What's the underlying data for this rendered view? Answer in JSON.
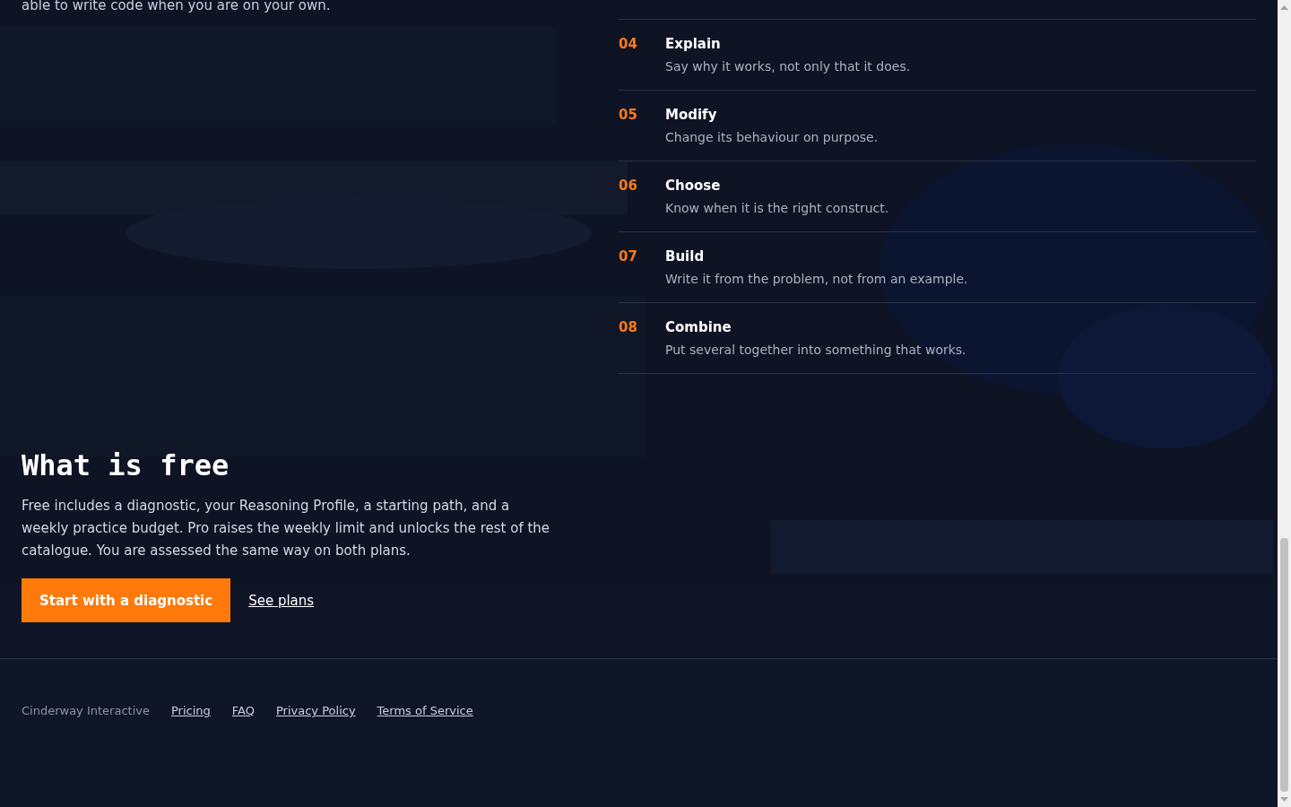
{
  "intro_tail": "able to write code when you are on your own.",
  "steps": [
    {
      "number": "04",
      "title": "Explain",
      "text": "Say why it works, not only that it does."
    },
    {
      "number": "05",
      "title": "Modify",
      "text": "Change its behaviour on purpose."
    },
    {
      "number": "06",
      "title": "Choose",
      "text": "Know when it is the right construct."
    },
    {
      "number": "07",
      "title": "Build",
      "text": "Write it from the problem, not from an example."
    },
    {
      "number": "08",
      "title": "Combine",
      "text": "Put several together into something that works."
    }
  ],
  "free": {
    "heading": "What is free",
    "text": "Free includes a diagnostic, your Reasoning Profile, a starting path, and a weekly practice budget. Pro raises the weekly limit and unlocks the rest of the catalogue. You are assessed the same way on both plans.",
    "primary_button": "Start with a diagnostic",
    "link": "See plans"
  },
  "footer": {
    "company": "Cinderway Interactive",
    "links": [
      "Pricing",
      "FAQ",
      "Privacy Policy",
      "Terms of Service"
    ]
  }
}
